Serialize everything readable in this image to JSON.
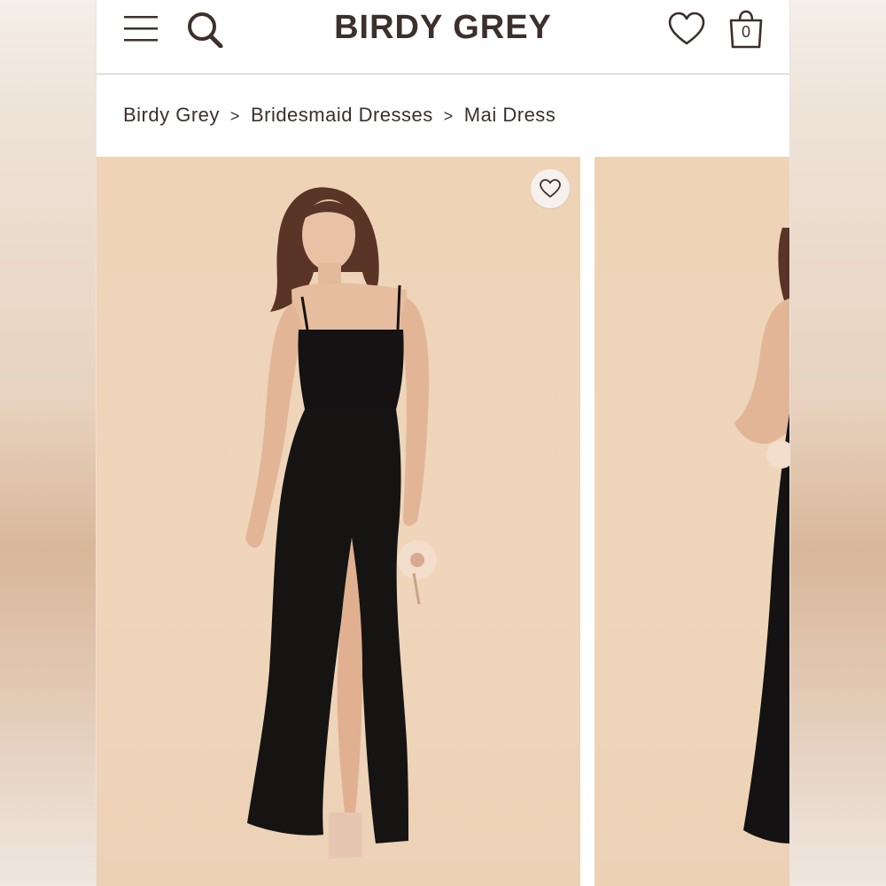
{
  "header": {
    "logo": "BIRDY GREY",
    "bag_count": "0"
  },
  "breadcrumb": {
    "items": [
      "Birdy Grey",
      "Bridesmaid Dresses",
      "Mai Dress"
    ],
    "separator": ">"
  },
  "colors": {
    "text_dark": "#3b302c",
    "photo_background": "#eed3b6",
    "dress": "#141212"
  },
  "icons": {
    "menu": "hamburger-menu-icon",
    "search": "search-icon",
    "wishlist": "heart-icon",
    "bag": "shopping-bag-icon",
    "favorite": "heart-outline-icon"
  }
}
